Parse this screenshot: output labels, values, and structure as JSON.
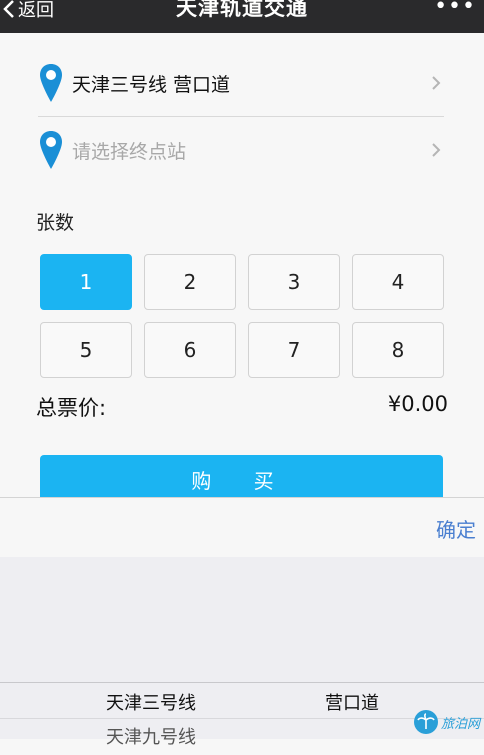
{
  "nav": {
    "back_label": "返回",
    "title": "天津轨道交通",
    "more_label": "•••"
  },
  "stations": {
    "origin": "天津三号线 营口道",
    "destination_placeholder": "请选择终点站"
  },
  "tickets": {
    "label": "张数",
    "options": [
      "1",
      "2",
      "3",
      "4",
      "5",
      "6",
      "7",
      "8"
    ],
    "selected": "1"
  },
  "total": {
    "label": "总票价:",
    "value": "¥0.00"
  },
  "buy_label": "购 买",
  "picker": {
    "confirm_label": "确定",
    "selected_line": "天津三号线",
    "selected_station": "营口道",
    "next_line": "天津九号线"
  },
  "watermark": {
    "text": "旅泊网"
  },
  "colors": {
    "accent": "#1bb4f2",
    "navbar": "#2a2a2c",
    "confirm": "#4a7fd0",
    "pin": "#1a8fd6"
  }
}
